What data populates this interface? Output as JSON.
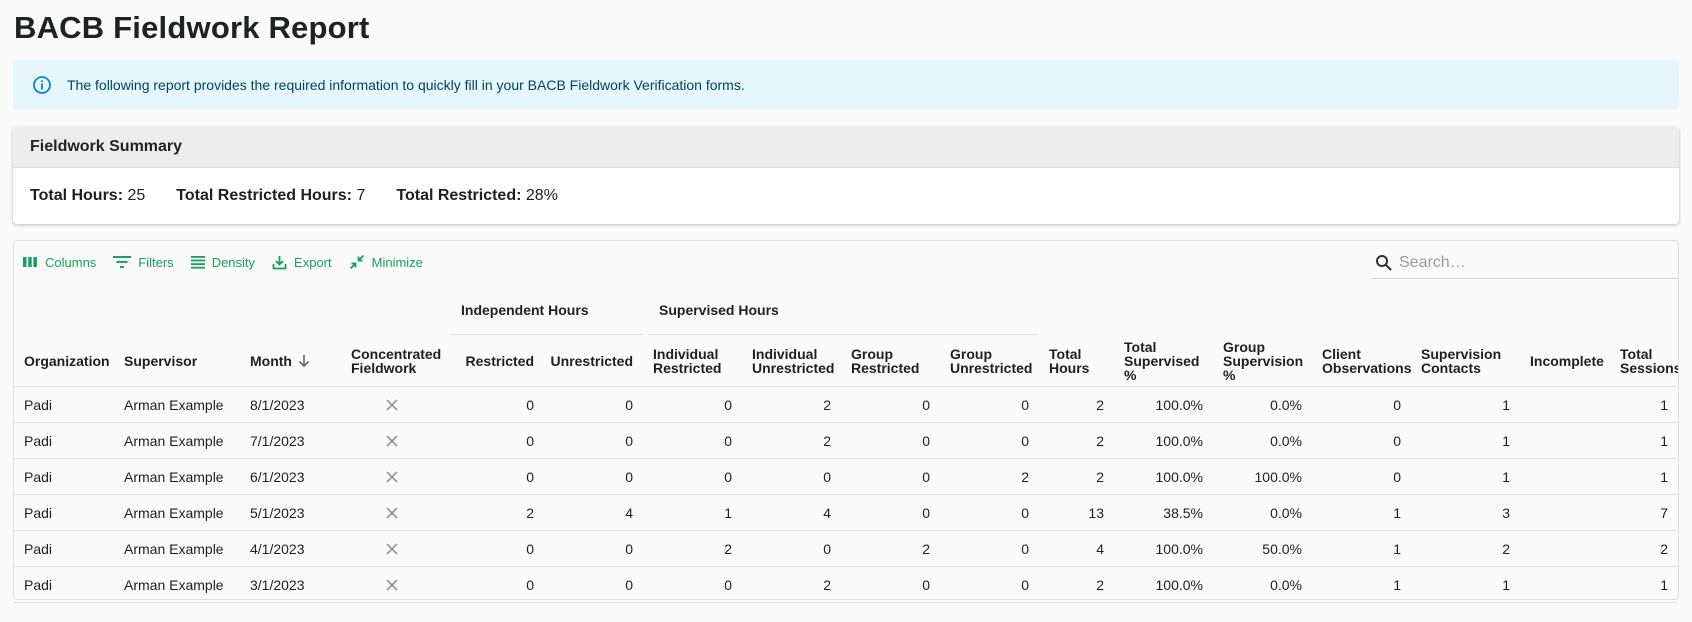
{
  "page": {
    "title": "BACB Fieldwork Report"
  },
  "alert": {
    "icon": "info-icon",
    "text": "The following report provides the required information to quickly fill in your BACB Fieldwork Verification forms."
  },
  "summary": {
    "title": "Fieldwork Summary",
    "total_hours_label": "Total Hours:",
    "total_hours_value": "25",
    "total_restricted_hours_label": "Total Restricted Hours:",
    "total_restricted_hours_value": "7",
    "total_restricted_label": "Total Restricted:",
    "total_restricted_value": "28%"
  },
  "toolbar": {
    "columns": "Columns",
    "filters": "Filters",
    "density": "Density",
    "export": "Export",
    "minimize": "Minimize"
  },
  "search": {
    "placeholder": "Search…"
  },
  "column_groups": {
    "independent": "Independent Hours",
    "supervised": "Supervised Hours"
  },
  "columns": {
    "organization": "Organization",
    "supervisor": "Supervisor",
    "month": "Month",
    "concentrated": "Concentrated Fieldwork",
    "restricted": "Restricted",
    "unrestricted": "Unrestricted",
    "individual_restricted": "Individual Restricted",
    "individual_unrestricted": "Individual Unrestricted",
    "group_restricted": "Group Restricted",
    "group_unrestricted": "Group Unrestricted",
    "total_hours": "Total Hours",
    "total_supervised": "Total Supervised %",
    "group_supervision": "Group Supervision %",
    "client_observations": "Client Observations",
    "supervision_contacts": "Supervision Contacts",
    "incomplete": "Incomplete",
    "total_sessions": "Total Sessions"
  },
  "rows": [
    {
      "organization": "Padi",
      "supervisor": "Arman Example",
      "month": "8/1/2023",
      "restricted": "0",
      "unrestricted": "0",
      "individual_restricted": "0",
      "individual_unrestricted": "2",
      "group_restricted": "0",
      "group_unrestricted": "0",
      "total_hours": "2",
      "total_supervised": "100.0%",
      "group_supervision": "0.0%",
      "client_observations": "0",
      "supervision_contacts": "1",
      "incomplete": "",
      "total_sessions": "1"
    },
    {
      "organization": "Padi",
      "supervisor": "Arman Example",
      "month": "7/1/2023",
      "restricted": "0",
      "unrestricted": "0",
      "individual_restricted": "0",
      "individual_unrestricted": "2",
      "group_restricted": "0",
      "group_unrestricted": "0",
      "total_hours": "2",
      "total_supervised": "100.0%",
      "group_supervision": "0.0%",
      "client_observations": "0",
      "supervision_contacts": "1",
      "incomplete": "",
      "total_sessions": "1"
    },
    {
      "organization": "Padi",
      "supervisor": "Arman Example",
      "month": "6/1/2023",
      "restricted": "0",
      "unrestricted": "0",
      "individual_restricted": "0",
      "individual_unrestricted": "0",
      "group_restricted": "0",
      "group_unrestricted": "2",
      "total_hours": "2",
      "total_supervised": "100.0%",
      "group_supervision": "100.0%",
      "client_observations": "0",
      "supervision_contacts": "1",
      "incomplete": "",
      "total_sessions": "1"
    },
    {
      "organization": "Padi",
      "supervisor": "Arman Example",
      "month": "5/1/2023",
      "restricted": "2",
      "unrestricted": "4",
      "individual_restricted": "1",
      "individual_unrestricted": "4",
      "group_restricted": "0",
      "group_unrestricted": "0",
      "total_hours": "13",
      "total_supervised": "38.5%",
      "group_supervision": "0.0%",
      "client_observations": "1",
      "supervision_contacts": "3",
      "incomplete": "",
      "total_sessions": "7"
    },
    {
      "organization": "Padi",
      "supervisor": "Arman Example",
      "month": "4/1/2023",
      "restricted": "0",
      "unrestricted": "0",
      "individual_restricted": "2",
      "individual_unrestricted": "0",
      "group_restricted": "2",
      "group_unrestricted": "0",
      "total_hours": "4",
      "total_supervised": "100.0%",
      "group_supervision": "50.0%",
      "client_observations": "1",
      "supervision_contacts": "2",
      "incomplete": "",
      "total_sessions": "2"
    },
    {
      "organization": "Padi",
      "supervisor": "Arman Example",
      "month": "3/1/2023",
      "restricted": "0",
      "unrestricted": "0",
      "individual_restricted": "0",
      "individual_unrestricted": "2",
      "group_restricted": "0",
      "group_unrestricted": "0",
      "total_hours": "2",
      "total_supervised": "100.0%",
      "group_supervision": "0.0%",
      "client_observations": "1",
      "supervision_contacts": "1",
      "incomplete": "",
      "total_sessions": "1"
    }
  ],
  "colors": {
    "accent": "#17a05e",
    "alert_bg": "#e5f6fd",
    "alert_text": "#014361",
    "info_icon": "#0288d1"
  }
}
